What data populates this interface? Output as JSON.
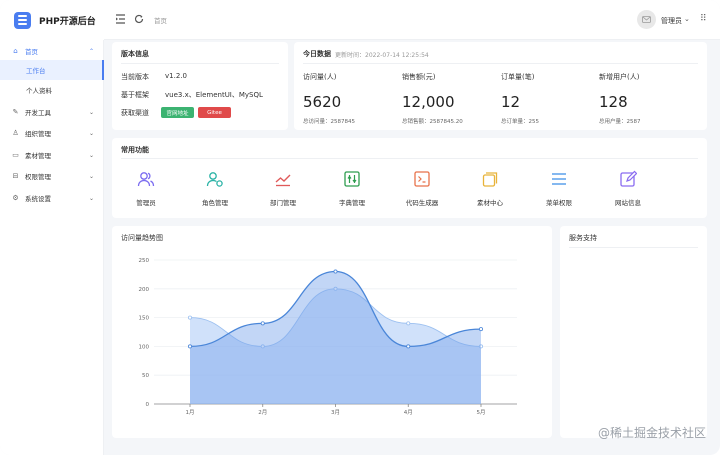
{
  "app": {
    "title": "PHP开源后台"
  },
  "header": {
    "breadcrumb": "首页",
    "user_name": "管理员"
  },
  "sidebar": {
    "items": [
      {
        "label": "首页",
        "icon": "home-icon",
        "expanded": true
      },
      {
        "label": "开发工具",
        "icon": "wrench-icon"
      },
      {
        "label": "组织管理",
        "icon": "org-icon"
      },
      {
        "label": "素材管理",
        "icon": "folder-icon"
      },
      {
        "label": "权限管理",
        "icon": "lock-icon"
      },
      {
        "label": "系统设置",
        "icon": "gear-icon"
      }
    ],
    "sub_items": [
      {
        "label": "工作台",
        "active": true
      },
      {
        "label": "个人资料"
      }
    ]
  },
  "version_card": {
    "title": "版本信息",
    "rows": [
      {
        "key": "当前版本",
        "value": "v1.2.0"
      },
      {
        "key": "基于框架",
        "value": "vue3.x、ElementUI、MySQL"
      },
      {
        "key": "获取渠道",
        "value": ""
      }
    ],
    "btn_official": "官网地址",
    "btn_gitee": "Gitee",
    "color_official": "#3cb371",
    "color_gitee": "#e04a4a"
  },
  "today_card": {
    "title": "今日数据",
    "update_time": "更新时间：2022-07-14 12:25:54",
    "stats": [
      {
        "label": "访问量(人)",
        "value": "5620",
        "total": "总访问量：2587845"
      },
      {
        "label": "销售额(元)",
        "value": "12,000",
        "total": "总销售额：2587845.20"
      },
      {
        "label": "订单量(笔)",
        "value": "12",
        "total": "总订单量：255"
      },
      {
        "label": "新增用户(人)",
        "value": "128",
        "total": "总用户量：2587"
      }
    ]
  },
  "features": {
    "title": "常用功能",
    "items": [
      {
        "label": "管理员",
        "icon": "admin-users-icon",
        "color": "#7b6cf0"
      },
      {
        "label": "角色管理",
        "icon": "role-icon",
        "color": "#2bb3a6"
      },
      {
        "label": "部门管理",
        "icon": "dept-chart-icon",
        "color": "#e05a5a"
      },
      {
        "label": "字典管理",
        "icon": "dictionary-icon",
        "color": "#2e9d4f"
      },
      {
        "label": "代码生成器",
        "icon": "code-gen-icon",
        "color": "#e8724a"
      },
      {
        "label": "素材中心",
        "icon": "material-icon",
        "color": "#e8b33a"
      },
      {
        "label": "菜单权限",
        "icon": "menu-list-icon",
        "color": "#3b8de8"
      },
      {
        "label": "网站信息",
        "icon": "site-edit-icon",
        "color": "#8a6cf0"
      }
    ]
  },
  "trend_card": {
    "title": "访问量趋势图"
  },
  "support_card": {
    "title": "服务支持"
  },
  "watermark": "@稀土掘金技术社区",
  "chart_data": {
    "type": "area",
    "categories": [
      "1月",
      "2月",
      "3月",
      "4月",
      "5月"
    ],
    "ylim": [
      0,
      250
    ],
    "yticks": [
      0,
      50,
      100,
      150,
      200,
      250
    ],
    "series": [
      {
        "values": [
          150,
          100,
          200,
          140,
          100
        ],
        "color": "#9cc0f0"
      },
      {
        "values": [
          100,
          140,
          230,
          100,
          130
        ],
        "color": "#4a86d8"
      }
    ],
    "grid": true
  }
}
